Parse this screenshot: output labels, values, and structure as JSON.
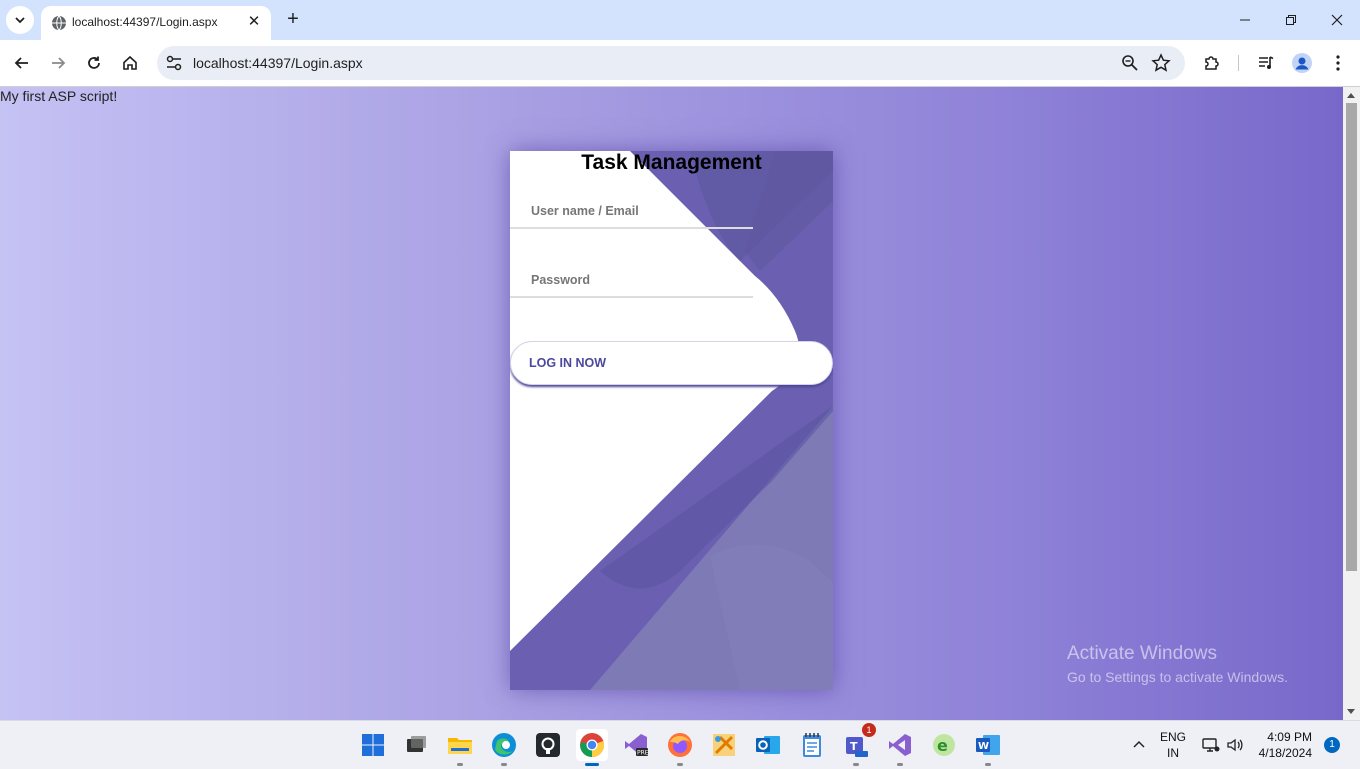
{
  "browser": {
    "tab_title": "localhost:44397/Login.aspx",
    "url": "localhost:44397/Login.aspx"
  },
  "page": {
    "script_text": "My first ASP script!",
    "card": {
      "title": "Task Management",
      "username_placeholder": "User name / Email",
      "password_placeholder": "Password",
      "login_label": "LOG IN NOW"
    },
    "watermark": {
      "line1": "Activate Windows",
      "line2": "Go to Settings to activate Windows."
    }
  },
  "taskbar": {
    "apps": [
      "start-icon",
      "task-view-icon",
      "file-explorer-icon",
      "edge-icon",
      "github-desktop-icon",
      "chrome-icon",
      "visual-studio-preview-icon",
      "firefox-icon",
      "tools-icon",
      "outlook-icon",
      "notepad-icon",
      "teams-icon",
      "visual-studio-icon",
      "excel-like-icon",
      "word-icon"
    ],
    "teams_badge": "1",
    "lang_line1": "ENG",
    "lang_line2": "IN",
    "time": "4:09 PM",
    "date": "4/18/2024",
    "notification_count": "1"
  },
  "colors": {
    "accent": "#4c489d",
    "card_purple": "#6a5fb0",
    "taskbar_accent": "#0067c0"
  }
}
